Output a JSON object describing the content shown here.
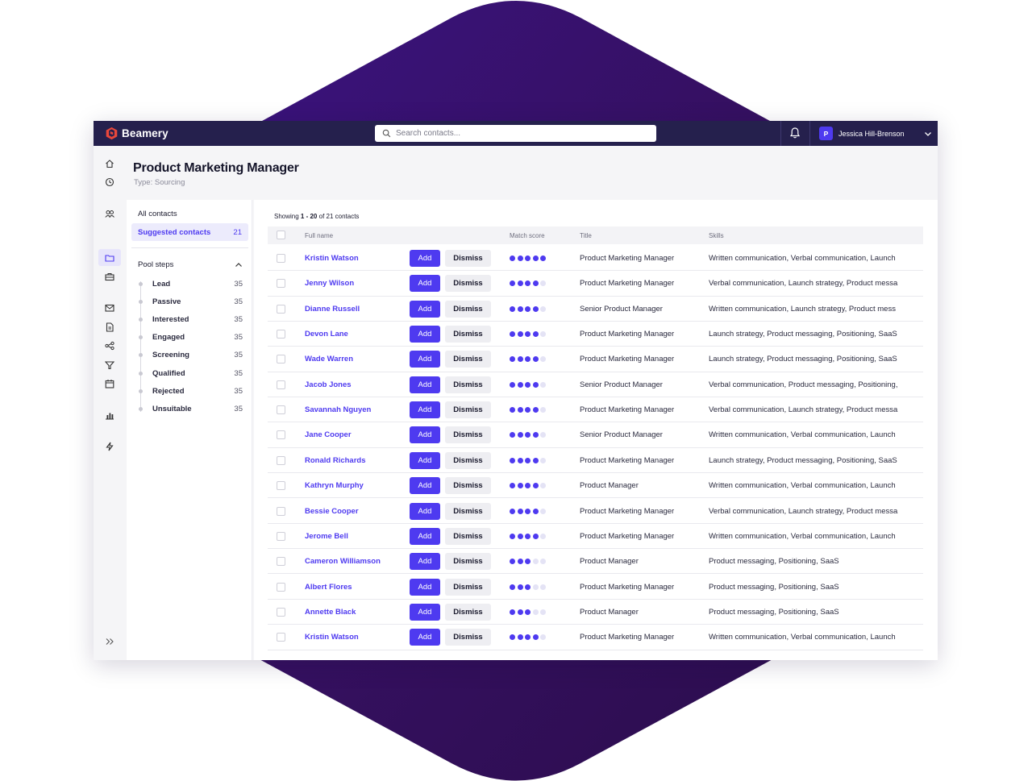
{
  "brand": {
    "name": "Beamery",
    "accent": "#4e3af0",
    "topbar_color": "#25204d"
  },
  "search": {
    "placeholder": "Search contacts..."
  },
  "user": {
    "initial": "P",
    "name": "Jessica Hill-Brenson"
  },
  "rail_icons": [
    "home-icon",
    "clock-icon",
    "people-icon",
    "folder-icon",
    "briefcase-icon",
    "mail-icon",
    "document-icon",
    "network-icon",
    "filter-icon",
    "calendar-icon",
    "chart-icon",
    "lightning-icon",
    "expand-icon"
  ],
  "page": {
    "title": "Product Marketing Manager",
    "subtitle": "Type: Sourcing"
  },
  "panel": {
    "all_contacts": "All contacts",
    "suggested": {
      "label": "Suggested contacts",
      "count": "21"
    },
    "pool_title": "Pool steps",
    "steps": [
      {
        "label": "Lead",
        "count": "35"
      },
      {
        "label": "Passive",
        "count": "35"
      },
      {
        "label": "Interested",
        "count": "35"
      },
      {
        "label": "Engaged",
        "count": "35"
      },
      {
        "label": "Screening",
        "count": "35"
      },
      {
        "label": "Qualified",
        "count": "35"
      },
      {
        "label": "Rejected",
        "count": "35"
      },
      {
        "label": "Unsuitable",
        "count": "35"
      }
    ]
  },
  "showing": {
    "prefix": "Showing ",
    "range": "1 - 20",
    "suffix": " of 21 contacts"
  },
  "table": {
    "headers": {
      "name": "Full name",
      "score": "Match score",
      "title": "Title",
      "skills": "Skills"
    },
    "add_label": "Add",
    "dismiss_label": "Dismiss",
    "rows": [
      {
        "name": "Kristin Watson",
        "score": 5,
        "title": "Product Marketing Manager",
        "skills": "Written communication, Verbal communication, Launch"
      },
      {
        "name": "Jenny Wilson",
        "score": 4,
        "title": "Product Marketing Manager",
        "skills": "Verbal communication, Launch strategy, Product messa"
      },
      {
        "name": "Dianne Russell",
        "score": 4,
        "title": "Senior Product Manager",
        "skills": "Written communication, Launch strategy, Product mess"
      },
      {
        "name": "Devon Lane",
        "score": 4,
        "title": "Product Marketing Manager",
        "skills": "Launch strategy, Product messaging, Positioning, SaaS"
      },
      {
        "name": "Wade Warren",
        "score": 4,
        "title": "Product Marketing Manager",
        "skills": "Launch strategy, Product messaging, Positioning, SaaS"
      },
      {
        "name": "Jacob Jones",
        "score": 4,
        "title": "Senior Product Manager",
        "skills": "Verbal communication, Product messaging, Positioning,"
      },
      {
        "name": "Savannah Nguyen",
        "score": 4,
        "title": "Product Marketing Manager",
        "skills": "Verbal communication, Launch strategy, Product messa"
      },
      {
        "name": "Jane Cooper",
        "score": 4,
        "title": "Senior Product Manager",
        "skills": "Written communication, Verbal communication, Launch"
      },
      {
        "name": "Ronald Richards",
        "score": 4,
        "title": "Product Marketing Manager",
        "skills": "Launch strategy, Product messaging, Positioning, SaaS"
      },
      {
        "name": "Kathryn Murphy",
        "score": 4,
        "title": "Product Manager",
        "skills": "Written communication, Verbal communication, Launch"
      },
      {
        "name": "Bessie Cooper",
        "score": 4,
        "title": "Product Marketing Manager",
        "skills": "Verbal communication, Launch strategy, Product messa"
      },
      {
        "name": "Jerome Bell",
        "score": 4,
        "title": "Product Marketing Manager",
        "skills": "Written communication, Verbal communication, Launch"
      },
      {
        "name": "Cameron Williamson",
        "score": 3,
        "title": "Product Manager",
        "skills": "Product messaging, Positioning, SaaS"
      },
      {
        "name": "Albert Flores",
        "score": 3,
        "title": "Product Marketing Manager",
        "skills": "Product messaging, Positioning, SaaS"
      },
      {
        "name": "Annette Black",
        "score": 3,
        "title": "Product Manager",
        "skills": "Product messaging, Positioning, SaaS"
      },
      {
        "name": "Kristin Watson",
        "score": 4,
        "title": "Product Marketing Manager",
        "skills": "Written communication, Verbal communication, Launch"
      }
    ]
  }
}
